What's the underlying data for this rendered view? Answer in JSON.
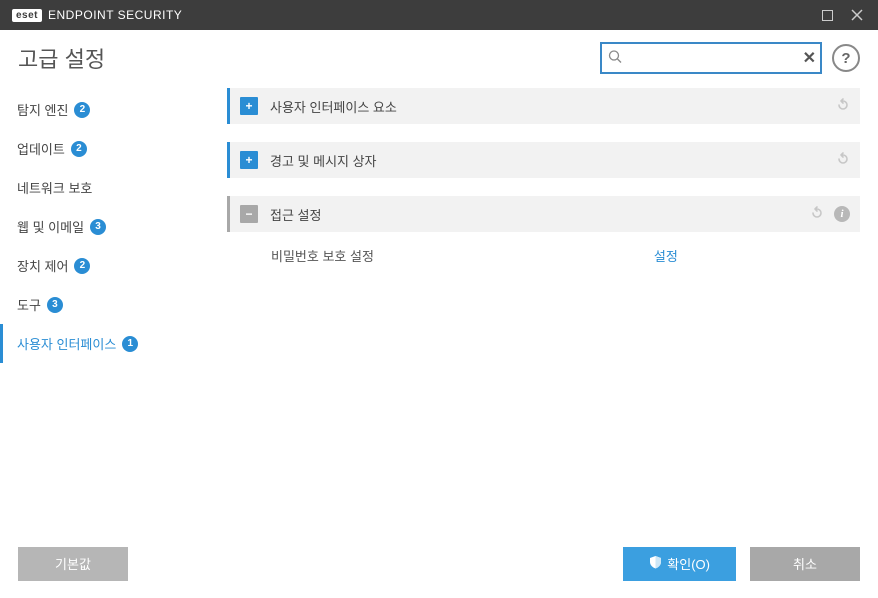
{
  "titlebar": {
    "logo_badge": "eset",
    "product": "ENDPOINT SECURITY"
  },
  "header": {
    "title": "고급 설정",
    "search_placeholder": ""
  },
  "sidebar": {
    "items": [
      {
        "label": "탐지 엔진",
        "badge": "2",
        "active": false
      },
      {
        "label": "업데이트",
        "badge": "2",
        "active": false
      },
      {
        "label": "네트워크 보호",
        "badge": null,
        "active": false
      },
      {
        "label": "웹 및 이메일",
        "badge": "3",
        "active": false
      },
      {
        "label": "장치 제어",
        "badge": "2",
        "active": false
      },
      {
        "label": "도구",
        "badge": "3",
        "active": false
      },
      {
        "label": "사용자 인터페이스",
        "badge": "1",
        "active": true
      }
    ]
  },
  "sections": {
    "ui_elements": {
      "title": "사용자 인터페이스 요소"
    },
    "alerts": {
      "title": "경고 및 메시지 상자"
    },
    "access": {
      "title": "접근 설정",
      "rows": [
        {
          "label": "비밀번호 보호 설정",
          "action": "설정"
        }
      ]
    }
  },
  "footer": {
    "default": "기본값",
    "ok": "확인(O)",
    "cancel": "취소"
  }
}
